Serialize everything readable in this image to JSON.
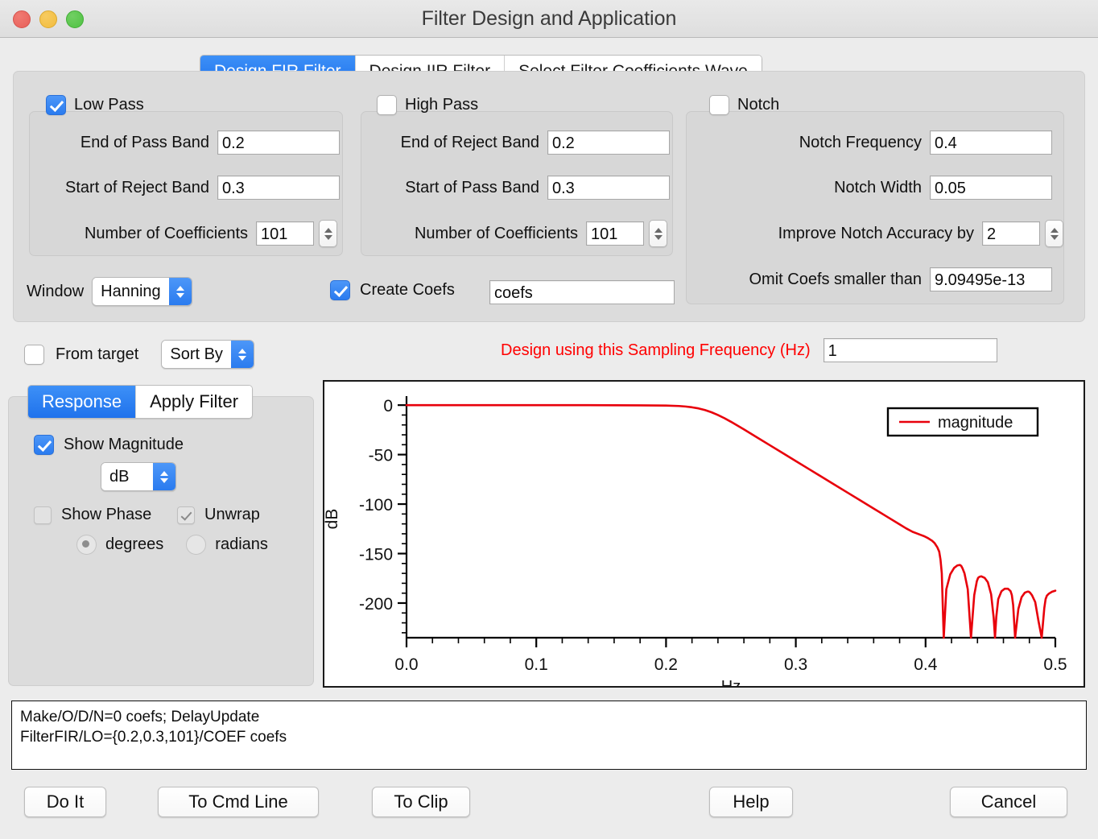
{
  "window": {
    "title": "Filter Design and Application",
    "traffic_lights": [
      "close-button",
      "minimize-button",
      "zoom-button"
    ]
  },
  "top_tabs": [
    {
      "label": "Design FIR Filter",
      "active": true
    },
    {
      "label": "Design IIR Filter",
      "active": false
    },
    {
      "label": "Select Filter Coefficients Wave",
      "active": false
    }
  ],
  "low_pass": {
    "checkbox_label": "Low Pass",
    "checked": true,
    "fields": [
      {
        "label": "End of Pass Band",
        "value": "0.2"
      },
      {
        "label": "Start of Reject Band",
        "value": "0.3"
      },
      {
        "label": "Number of Coefficients",
        "value": "101"
      }
    ]
  },
  "high_pass": {
    "checkbox_label": "High Pass",
    "checked": false,
    "fields": [
      {
        "label": "End of Reject Band",
        "value": "0.2"
      },
      {
        "label": "Start of Pass Band",
        "value": "0.3"
      },
      {
        "label": "Number of Coefficients",
        "value": "101"
      }
    ]
  },
  "notch": {
    "checkbox_label": "Notch",
    "checked": false,
    "fields": [
      {
        "label": "Notch Frequency",
        "value": "0.4"
      },
      {
        "label": "Notch Width",
        "value": "0.05"
      },
      {
        "label": "Improve Notch Accuracy by",
        "value": "2"
      },
      {
        "label": "Omit Coefs smaller than",
        "value": "9.09495e-13"
      }
    ]
  },
  "window_row": {
    "label": "Window",
    "selected": "Hanning"
  },
  "create_coefs": {
    "label": "Create Coefs",
    "checked": true,
    "wave_name": "coefs"
  },
  "from_target": {
    "label": "From target",
    "checked": false,
    "sort_by_selected": "Sort By"
  },
  "sampling": {
    "label": "Design using this Sampling Frequency (Hz)",
    "value": "1",
    "color": "#ff0000"
  },
  "sub_tabs": [
    {
      "label": "Response",
      "active": true
    },
    {
      "label": "Apply Filter",
      "active": false
    }
  ],
  "response_options": {
    "show_magnitude": {
      "label": "Show Magnitude",
      "checked": true
    },
    "units_selected": "dB",
    "show_phase": {
      "label": "Show Phase",
      "checked": false,
      "enabled": false
    },
    "unwrap": {
      "label": "Unwrap",
      "checked": true,
      "enabled": false
    },
    "degrees": {
      "label": "degrees",
      "selected": true
    },
    "radians": {
      "label": "radians",
      "selected": false
    }
  },
  "chart_data": {
    "type": "line",
    "title": "",
    "xlabel": "Hz",
    "ylabel": "dB",
    "xlim": [
      0.0,
      0.5
    ],
    "ylim": [
      -235,
      5
    ],
    "grid": false,
    "legend_position": "top-right",
    "xticks": [
      "0.0",
      "0.1",
      "0.2",
      "0.3",
      "0.4",
      "0.5"
    ],
    "xtick_values": [
      0.0,
      0.1,
      0.2,
      0.3,
      0.4,
      0.5
    ],
    "minor_ticks_per_major_x": 5,
    "yticks": [
      "0",
      "-50",
      "-100",
      "-150",
      "-200"
    ],
    "ytick_values": [
      0,
      -50,
      -100,
      -150,
      -200
    ],
    "series": [
      {
        "name": "magnitude",
        "color": "#e8000b",
        "x": [
          0.0,
          0.02,
          0.04,
          0.06,
          0.08,
          0.1,
          0.12,
          0.14,
          0.16,
          0.18,
          0.2,
          0.21,
          0.215,
          0.22,
          0.225,
          0.23,
          0.235,
          0.24,
          0.245,
          0.25,
          0.26,
          0.27,
          0.28,
          0.29,
          0.3,
          0.31,
          0.32,
          0.33,
          0.34,
          0.35,
          0.36,
          0.37,
          0.38,
          0.385,
          0.39,
          0.393,
          0.396,
          0.399,
          0.402,
          0.405,
          0.407,
          0.409,
          0.4105,
          0.4115,
          0.4125,
          0.414,
          0.416,
          0.419,
          0.422,
          0.4245,
          0.4265,
          0.4275,
          0.4285,
          0.43,
          0.4325,
          0.435,
          0.4375,
          0.4395,
          0.4405,
          0.4415,
          0.443,
          0.4455,
          0.448,
          0.4505,
          0.4525,
          0.4535,
          0.4545,
          0.456,
          0.4585,
          0.461,
          0.4635,
          0.4655,
          0.4665,
          0.4675,
          0.469,
          0.4715,
          0.474,
          0.4765,
          0.4785,
          0.4795,
          0.4805,
          0.482,
          0.4845,
          0.487,
          0.4895,
          0.4915,
          0.4925,
          0.4935,
          0.495,
          0.4975,
          0.5
        ],
        "y": [
          0.0,
          0.0,
          0.0,
          0.0,
          0.0,
          0.0,
          0.0,
          -0.05,
          -0.1,
          -0.2,
          -0.4,
          -0.9,
          -1.4,
          -2.2,
          -3.3,
          -5.0,
          -7.2,
          -10.0,
          -13.2,
          -16.8,
          -24.5,
          -32.5,
          -40.5,
          -48.5,
          -56.5,
          -64.5,
          -72.5,
          -80.5,
          -88.5,
          -96.5,
          -104.5,
          -112.5,
          -120.5,
          -124.5,
          -128.0,
          -129.5,
          -131.0,
          -132.5,
          -134.5,
          -137.0,
          -139.5,
          -143.5,
          -148.0,
          -156.0,
          -170.0,
          -235.0,
          -186.0,
          -171.0,
          -164.5,
          -162.0,
          -161.5,
          -162.5,
          -165.0,
          -170.0,
          -186.0,
          -235.0,
          -192.0,
          -178.0,
          -174.5,
          -173.5,
          -173.0,
          -174.5,
          -179.0,
          -191.0,
          -215.0,
          -235.0,
          -214.0,
          -196.0,
          -188.0,
          -185.5,
          -185.5,
          -188.0,
          -192.0,
          -202.0,
          -235.0,
          -206.0,
          -194.0,
          -189.5,
          -188.5,
          -188.5,
          -189.5,
          -192.0,
          -199.0,
          -218.0,
          -235.0,
          -205.0,
          -196.0,
          -192.5,
          -190.5,
          -188.5,
          -187.5
        ]
      }
    ],
    "legend": [
      {
        "label": "magnitude",
        "color": "#e8000b"
      }
    ]
  },
  "command_text": {
    "line1": "Make/O/D/N=0 coefs; DelayUpdate",
    "line2": "FilterFIR/LO={0.2,0.3,101}/COEF coefs"
  },
  "bottom_buttons": [
    {
      "label": "Do It"
    },
    {
      "label": "To Cmd Line"
    },
    {
      "label": "To Clip"
    },
    {
      "label": "Help"
    },
    {
      "label": "Cancel"
    }
  ]
}
